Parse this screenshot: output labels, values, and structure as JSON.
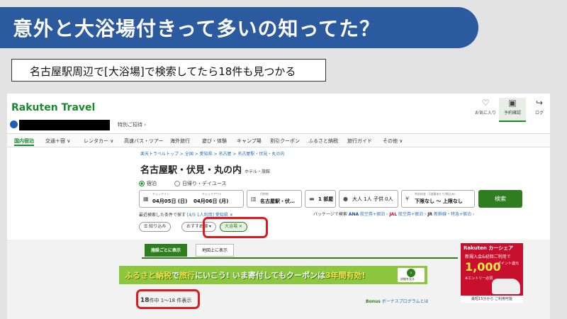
{
  "slide": {
    "title": "意外と大浴場付きって多いの知ってた？",
    "subtitle": "名古屋駅周辺で[大浴場]で検索してたら18件も見つかる"
  },
  "site": {
    "logo_main": "Rakuten",
    "logo_sub": "Travel",
    "invite": "特別ご招待 ›",
    "header": {
      "favorites": "お気に入り",
      "reservations": "予約確認",
      "login": "ログ"
    }
  },
  "nav": [
    "国内宿泊",
    "交通＋宿 ∨",
    "レンタカー ∨",
    "高速バス・ツアー",
    "海外旅行",
    "遊び・体験",
    "キャンプ場",
    "割引クーポン",
    "ふるさと納税",
    "旅行ガイド",
    "その他 ∨"
  ],
  "breadcrumb": "楽天トラベルトップ > 全国 > 愛知県 > 名古屋 > 名古屋駅・伏見・丸の内",
  "page_title": "名古屋駅・伏見・丸の内",
  "page_title_sub": "ホテル・旅館",
  "search": {
    "radio_stay": "宿泊",
    "radio_day": "日帰り・デイユース",
    "checkin_label": "チェックイン",
    "checkin_value": "04月05日 (日)",
    "checkout_label": "チェックアウト",
    "checkout_value": "04月06日 (月)",
    "dest_label": "目的地",
    "dest_value": "名古屋駅・伏…",
    "rooms_value": "1 部屋",
    "guests_value": "大人 1人   子供 0人",
    "price_label": "合計料金（1部屋あたり/税込み）",
    "price_value": "下限なし   ～   上限なし",
    "button": "検索"
  },
  "recent": {
    "label": "最近検索した条件で探す",
    "link": "[4/5 1人利用] 愛知県 ✕"
  },
  "package": {
    "label": "パッケージで検索",
    "ana": "ANA",
    "ana_link": "航空券+宿泊 ›",
    "jal": "JAL",
    "jal_link": "航空券+宿泊 ›",
    "jr": "JR",
    "jr_link": "新幹線・特急+宿泊 ›"
  },
  "filters": {
    "narrow": "☰ 絞り込み",
    "sort": "おすすめ順 ▾",
    "tag": "大浴場 ✕"
  },
  "tabs": {
    "by_facility": "施設ごとに表示",
    "on_map": "地図上に表示"
  },
  "banner": {
    "part1": "ふるさと納税",
    "part2": "で",
    "part3": "旅行",
    "part4": "にいこう! いま寄付してもクーポンは",
    "part5": "3年間有効!",
    "detail": "詳細を見る"
  },
  "results": {
    "count": "18",
    "rest": "件中 1〜18 件表示"
  },
  "bonus": {
    "label": "Bonus",
    "text": "ボーナスプログラムとは"
  },
  "ad": {
    "brand": "Rakuten カーシェア",
    "line1": "新規入会&初回ご利用で",
    "amount": "1,000",
    "unit": "ポイント還元",
    "entry": "※エントリー必須",
    "foot": "最短15分から ご利用可能"
  }
}
